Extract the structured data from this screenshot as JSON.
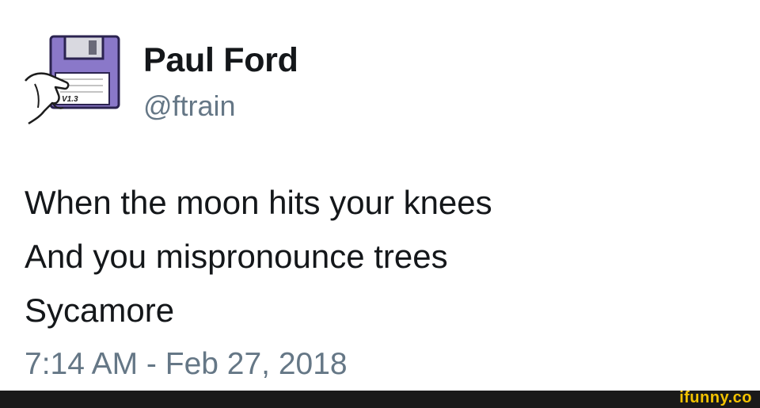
{
  "tweet": {
    "author_name": "Paul Ford",
    "handle": "@ftrain",
    "lines": [
      "When the moon hits your knees",
      "And you mispronounce trees",
      "Sycamore"
    ],
    "timestamp": "7:14 AM - Feb 27, 2018",
    "avatar_icon": "floppy-disk-hand-icon"
  },
  "footer": {
    "watermark": "ifunny.co",
    "background": "#1a1a1a",
    "accent": "#f2c200"
  }
}
